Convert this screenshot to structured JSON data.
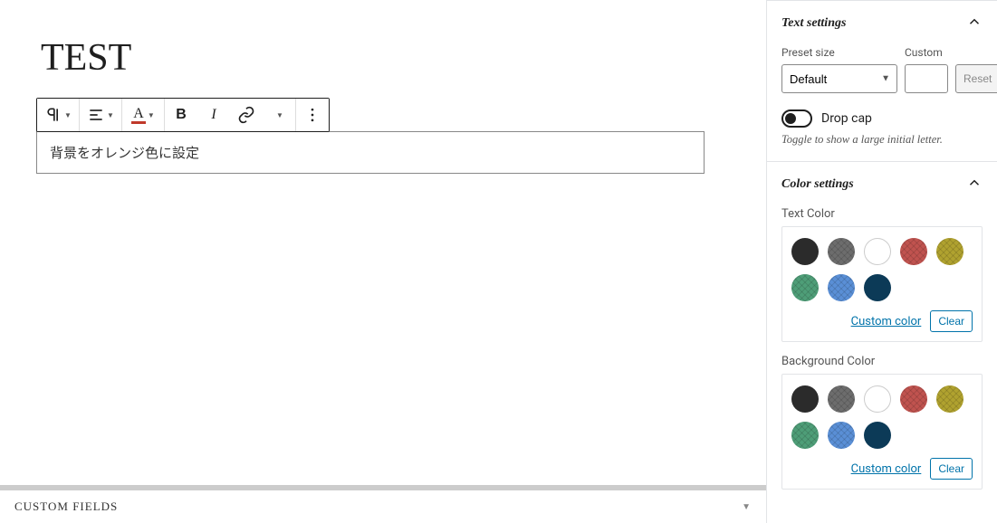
{
  "post": {
    "title": "TEST"
  },
  "block": {
    "content": "背景をオレンジ色に設定"
  },
  "toolbar": {
    "paragraph": "paragraph",
    "align": "align",
    "textcolor": "text-color",
    "bold": "B",
    "italic": "I",
    "link": "link",
    "more": "more"
  },
  "bottom": {
    "custom_fields": "CUSTOM FIELDS"
  },
  "sidebar": {
    "text_settings": {
      "title": "Text settings",
      "preset_label": "Preset size",
      "preset_value": "Default",
      "custom_label": "Custom",
      "custom_value": "",
      "reset": "Reset",
      "dropcap_label": "Drop cap",
      "dropcap_desc": "Toggle to show a large initial letter."
    },
    "color_settings": {
      "title": "Color settings",
      "text_color_label": "Text Color",
      "bg_color_label": "Background Color",
      "custom_color": "Custom color",
      "clear": "Clear",
      "palette": [
        {
          "name": "black",
          "hex": "#2b2b2b",
          "cross": false
        },
        {
          "name": "gray",
          "hex": "#6d6d6d",
          "cross": true
        },
        {
          "name": "white",
          "hex": "#ffffff",
          "cross": false
        },
        {
          "name": "red",
          "hex": "#c0534f",
          "cross": true
        },
        {
          "name": "olive",
          "hex": "#b0a22f",
          "cross": true
        },
        {
          "name": "green",
          "hex": "#4e9e78",
          "cross": true
        },
        {
          "name": "blue",
          "hex": "#5a8fd6",
          "cross": true
        },
        {
          "name": "navy",
          "hex": "#0c3a57",
          "cross": false
        }
      ]
    }
  }
}
